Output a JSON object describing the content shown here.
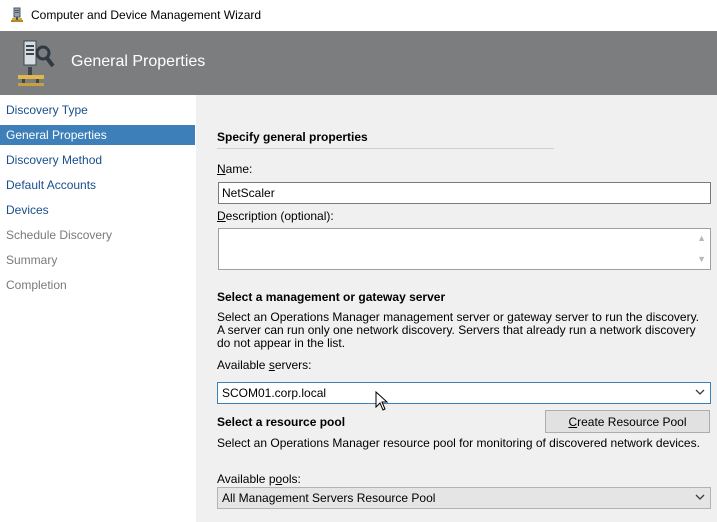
{
  "window": {
    "title": "Computer and Device Management Wizard",
    "icon": "wizard-app-icon"
  },
  "banner": {
    "heading": "General Properties",
    "icon": "discovery-wizard-icon"
  },
  "sidebar": {
    "items": [
      {
        "label": "Discovery Type",
        "state": "link"
      },
      {
        "label": "General Properties",
        "state": "active"
      },
      {
        "label": "Discovery Method",
        "state": "link"
      },
      {
        "label": "Default Accounts",
        "state": "link"
      },
      {
        "label": "Devices",
        "state": "link"
      },
      {
        "label": "Schedule Discovery",
        "state": "disabled"
      },
      {
        "label": "Summary",
        "state": "disabled"
      },
      {
        "label": "Completion",
        "state": "disabled"
      }
    ]
  },
  "main": {
    "section_title": "Specify general properties",
    "name": {
      "label_access": "N",
      "label_rest": "ame:",
      "value": "NetScaler"
    },
    "description": {
      "label_access": "D",
      "label_rest": "escription (optional):",
      "value": ""
    },
    "server_section": {
      "title": "Select a management or gateway server",
      "description": "Select an Operations Manager management server or gateway server to run the discovery. A server can run only one network discovery. Servers that already run a network discovery do not appear in the list.",
      "available_label_pre": "Available ",
      "available_label_access": "s",
      "available_label_post": "ervers:",
      "selected_server": "SCOM01.corp.local"
    },
    "pool_section": {
      "title": "Select a resource pool",
      "create_button_access": "C",
      "create_button_rest": "reate Resource Pool",
      "description": "Select an Operations Manager resource pool for monitoring of discovered network devices.",
      "available_label_pre": "Available p",
      "available_label_access": "o",
      "available_label_post": "ols:",
      "selected_pool": "All Management Servers Resource Pool"
    }
  },
  "colors": {
    "banner": "#7c7d7f",
    "active_nav": "#3c7fb9",
    "link": "#1a4e8c",
    "content_bg": "#f0f0f0"
  }
}
